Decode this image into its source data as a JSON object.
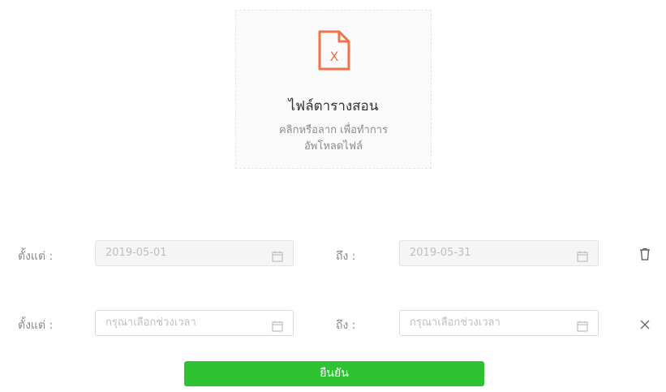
{
  "upload": {
    "icon": "excel-file-icon",
    "title": "ไฟล์ตารางสอน",
    "hint_line1": "คลิกหรือลาก เพื่อทำการ",
    "hint_line2": "อัพโหลดไฟล์",
    "accent_color": "#f0734a"
  },
  "rows": [
    {
      "from_label": "ตั้งแต่ :",
      "from_value": "2019-05-01",
      "to_label": "ถึง :",
      "to_value": "2019-05-31",
      "disabled": true,
      "action_icon": "trash-icon"
    },
    {
      "from_label": "ตั้งแต่ :",
      "from_placeholder": "กรุณาเลือกช่วงเวลา",
      "to_label": "ถึง :",
      "to_placeholder": "กรุณาเลือกช่วงเวลา",
      "disabled": false,
      "action_icon": "close-icon"
    }
  ],
  "confirm_label": "ยืนยัน",
  "colors": {
    "confirm": "#2fc334",
    "border": "#d9d9d9"
  }
}
